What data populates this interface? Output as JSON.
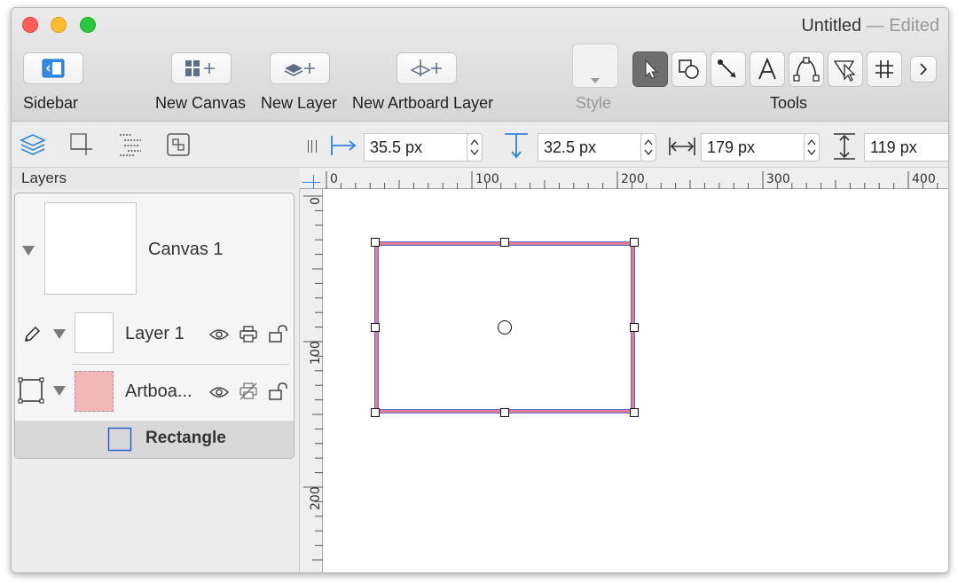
{
  "window": {
    "title": "Untitled",
    "separator": "—",
    "status": "Edited"
  },
  "toolbar": {
    "sidebar_label": "Sidebar",
    "new_canvas_label": "New Canvas",
    "new_layer_label": "New Layer",
    "new_artboard_layer_label": "New Artboard Layer",
    "style_label": "Style",
    "tools_label": "Tools",
    "tools": [
      "selection-arrow",
      "shape",
      "line",
      "text",
      "pen",
      "point-editor",
      "diagram-grid"
    ]
  },
  "sidebar": {
    "panel_title": "Layers",
    "canvas": {
      "label": "Canvas 1"
    },
    "layers": [
      {
        "label": "Layer 1"
      },
      {
        "label": "Artboa..."
      }
    ],
    "selected_object": {
      "label": "Rectangle"
    }
  },
  "inspector": {
    "x_value": "35.5 px",
    "y_value": "32.5 px",
    "width_value": "179 px",
    "height_value": "119 px"
  },
  "rulers": {
    "horizontal": [
      "0",
      "100",
      "200",
      "300",
      "400"
    ],
    "vertical": [
      "0",
      "100",
      "200"
    ]
  },
  "colors": {
    "selection_border": "#e57c8f",
    "selection_outline": "#5a6bd6",
    "accent": "#2e86de",
    "artboard_thumb": "#f2b8b8"
  }
}
